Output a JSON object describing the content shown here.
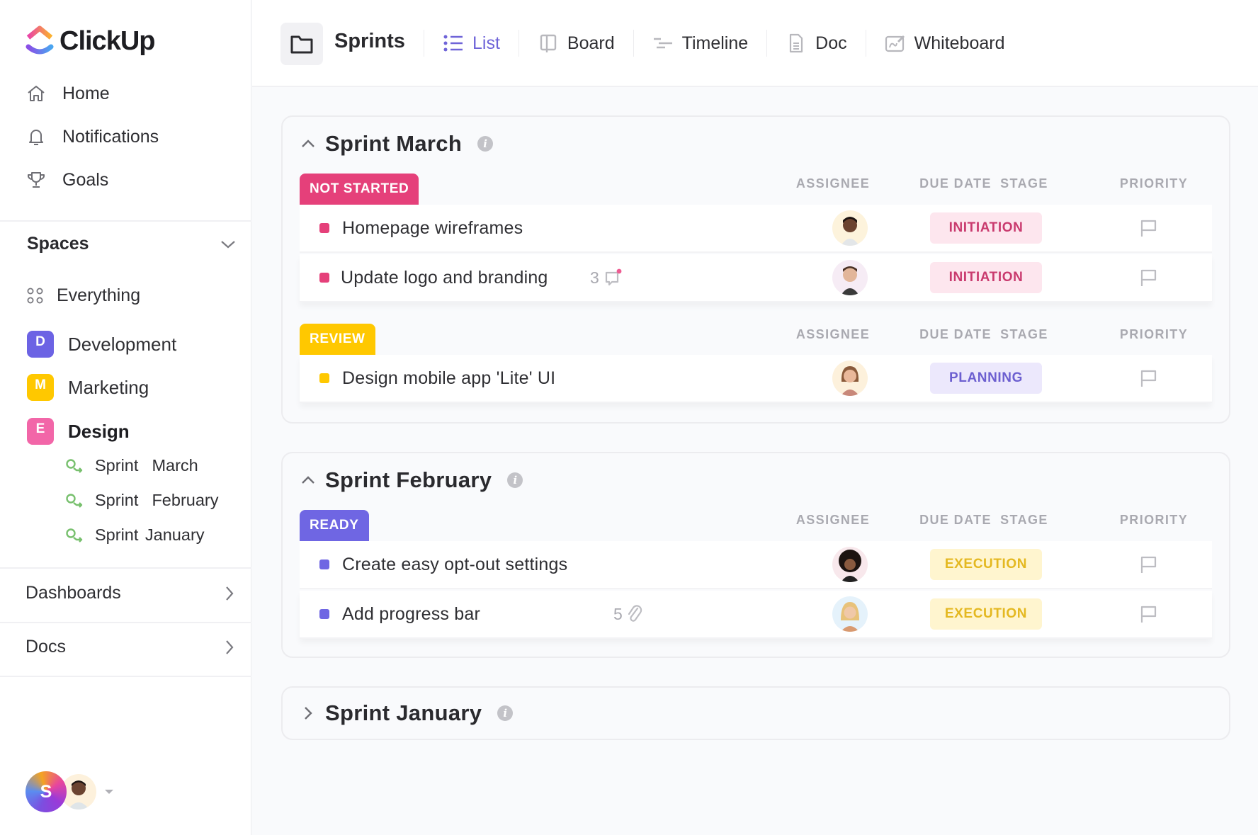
{
  "app": {
    "name": "ClickUp"
  },
  "sidebar": {
    "nav": [
      {
        "label": "Home",
        "icon": "home-icon"
      },
      {
        "label": "Notifications",
        "icon": "bell-icon"
      },
      {
        "label": "Goals",
        "icon": "trophy-icon"
      }
    ],
    "spaces_label": "Spaces",
    "everything_label": "Everything",
    "spaces": [
      {
        "letter": "D",
        "label": "Development",
        "color": "#6c63e4"
      },
      {
        "letter": "M",
        "label": "Marketing",
        "color": "#ffc800"
      },
      {
        "letter": "E",
        "label": "Design",
        "color": "#f266a8"
      }
    ],
    "design_lists": [
      {
        "label": "Sprint  March"
      },
      {
        "label": "Sprint  February"
      },
      {
        "label": "Sprint January"
      }
    ],
    "dashboards_label": "Dashboards",
    "docs_label": "Docs",
    "user": {
      "initial": "S"
    }
  },
  "header": {
    "title": "Sprints",
    "views": [
      {
        "label": "List",
        "icon": "list-icon",
        "active": true
      },
      {
        "label": "Board",
        "icon": "board-icon"
      },
      {
        "label": "Timeline",
        "icon": "timeline-icon"
      },
      {
        "label": "Doc",
        "icon": "doc-icon"
      },
      {
        "label": "Whiteboard",
        "icon": "whiteboard-icon"
      }
    ]
  },
  "columns": {
    "assignee": "ASSIGNEE",
    "due_date": "DUE DATE",
    "stage": "STAGE",
    "priority": "PRIORITY"
  },
  "sprints": [
    {
      "title": "Sprint March",
      "expanded": true,
      "groups": [
        {
          "status": "NOT STARTED",
          "color": "#e5407a",
          "tasks": [
            {
              "name": "Homepage wireframes",
              "stage": "INITIATION",
              "stage_fg": "#c93a6e",
              "stage_bg": "#fde6ee"
            },
            {
              "name": "Update logo and branding",
              "comments": "3",
              "stage": "INITIATION",
              "stage_fg": "#c93a6e",
              "stage_bg": "#fde6ee"
            }
          ]
        },
        {
          "status": "REVIEW",
          "color": "#ffc800",
          "tasks": [
            {
              "name": "Design mobile app 'Lite' UI",
              "stage": "PLANNING",
              "stage_fg": "#6c5fd0",
              "stage_bg": "#ece8fc"
            }
          ]
        }
      ]
    },
    {
      "title": "Sprint February",
      "expanded": true,
      "groups": [
        {
          "status": "READY",
          "color": "#6f66e3",
          "tasks": [
            {
              "name": "Create easy opt-out settings",
              "stage": "EXECUTION",
              "stage_fg": "#e4b820",
              "stage_bg": "#fff5cf"
            },
            {
              "name": "Add progress bar",
              "attachments": "5",
              "stage": "EXECUTION",
              "stage_fg": "#e4b820",
              "stage_bg": "#fff5cf"
            }
          ]
        }
      ]
    },
    {
      "title": "Sprint January",
      "expanded": false
    }
  ]
}
